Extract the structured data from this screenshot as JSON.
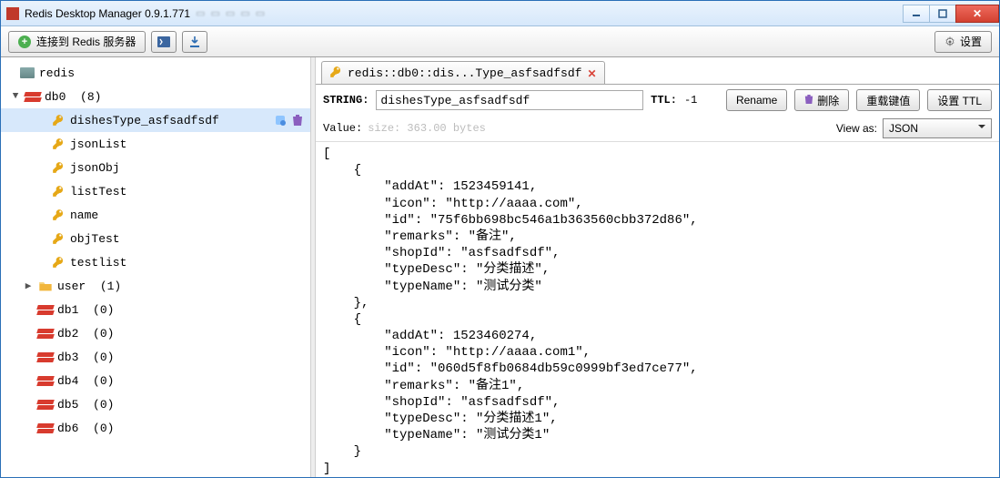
{
  "window": {
    "title": "Redis Desktop Manager 0.9.1.771"
  },
  "toolbar": {
    "connect_label": "连接到 Redis 服务器",
    "settings_label": "设置"
  },
  "tree": {
    "server": "redis",
    "db0": {
      "label": "db0",
      "count": "(8)"
    },
    "keys": [
      "dishesType_asfsadfsdf",
      "jsonList",
      "jsonObj",
      "listTest",
      "name",
      "objTest",
      "testlist"
    ],
    "folder": {
      "label": "user",
      "count": "(1)"
    },
    "dbs": [
      {
        "label": "db1",
        "count": "(0)"
      },
      {
        "label": "db2",
        "count": "(0)"
      },
      {
        "label": "db3",
        "count": "(0)"
      },
      {
        "label": "db4",
        "count": "(0)"
      },
      {
        "label": "db5",
        "count": "(0)"
      },
      {
        "label": "db6",
        "count": "(0)"
      }
    ]
  },
  "tab": {
    "label": "redis::db0::dis...Type_asfsadfsdf"
  },
  "info": {
    "type_label": "STRING:",
    "key_value": "dishesType_asfsadfsdf",
    "ttl_label": "TTL:",
    "ttl_value": "-1",
    "rename": "Rename",
    "delete": "删除",
    "reload": "重载键值",
    "set_ttl": "设置 TTL"
  },
  "valuebar": {
    "value_label": "Value:",
    "size_label": "size: 363.00 bytes",
    "view_as_label": "View as:",
    "view_as_value": "JSON"
  },
  "code_text": "[\n    {\n        \"addAt\": 1523459141,\n        \"icon\": \"http://aaaa.com\",\n        \"id\": \"75f6bb698bc546a1b363560cbb372d86\",\n        \"remarks\": \"备注\",\n        \"shopId\": \"asfsadfsdf\",\n        \"typeDesc\": \"分类描述\",\n        \"typeName\": \"测试分类\"\n    },\n    {\n        \"addAt\": 1523460274,\n        \"icon\": \"http://aaaa.com1\",\n        \"id\": \"060d5f8fb0684db59c0999bf3ed7ce77\",\n        \"remarks\": \"备注1\",\n        \"shopId\": \"asfsadfsdf\",\n        \"typeDesc\": \"分类描述1\",\n        \"typeName\": \"测试分类1\"\n    }\n]"
}
